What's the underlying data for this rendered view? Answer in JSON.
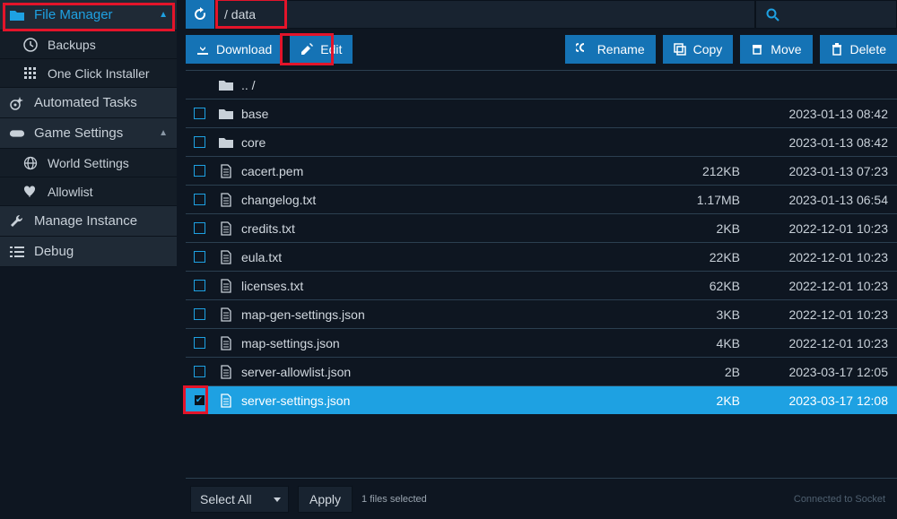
{
  "sidebar": {
    "sections": [
      {
        "id": "file-manager",
        "label": "File Manager",
        "active": true,
        "expandable": true,
        "children": [
          {
            "id": "backups",
            "label": "Backups",
            "icon": "backup"
          },
          {
            "id": "one-click",
            "label": "One Click Installer",
            "icon": "grid"
          }
        ]
      },
      {
        "id": "automated-tasks",
        "label": "Automated Tasks",
        "icon": "gear-spark",
        "expandable": false
      },
      {
        "id": "game-settings",
        "label": "Game Settings",
        "icon": "gamepad",
        "expandable": true,
        "children": [
          {
            "id": "world-settings",
            "label": "World Settings",
            "icon": "globe"
          },
          {
            "id": "allowlist",
            "label": "Allowlist",
            "icon": "heart"
          }
        ]
      },
      {
        "id": "manage-instance",
        "label": "Manage Instance",
        "icon": "wrench",
        "expandable": false
      },
      {
        "id": "debug",
        "label": "Debug",
        "icon": "list",
        "expandable": false
      }
    ]
  },
  "breadcrumb": {
    "path": "/   data"
  },
  "toolbar": {
    "download": "Download",
    "edit": "Edit",
    "rename": "Rename",
    "copy": "Copy",
    "move": "Move",
    "delete": "Delete"
  },
  "parent_label": ".. /",
  "files": [
    {
      "type": "folder",
      "name": "base",
      "size": "",
      "date": "2023-01-13 08:42",
      "selected": false
    },
    {
      "type": "folder",
      "name": "core",
      "size": "",
      "date": "2023-01-13 08:42",
      "selected": false
    },
    {
      "type": "file",
      "name": "cacert.pem",
      "size": "212KB",
      "date": "2023-01-13 07:23",
      "selected": false
    },
    {
      "type": "file",
      "name": "changelog.txt",
      "size": "1.17MB",
      "date": "2023-01-13 06:54",
      "selected": false
    },
    {
      "type": "file",
      "name": "credits.txt",
      "size": "2KB",
      "date": "2022-12-01 10:23",
      "selected": false
    },
    {
      "type": "file",
      "name": "eula.txt",
      "size": "22KB",
      "date": "2022-12-01 10:23",
      "selected": false
    },
    {
      "type": "file",
      "name": "licenses.txt",
      "size": "62KB",
      "date": "2022-12-01 10:23",
      "selected": false
    },
    {
      "type": "file",
      "name": "map-gen-settings.json",
      "size": "3KB",
      "date": "2022-12-01 10:23",
      "selected": false
    },
    {
      "type": "file",
      "name": "map-settings.json",
      "size": "4KB",
      "date": "2022-12-01 10:23",
      "selected": false
    },
    {
      "type": "file",
      "name": "server-allowlist.json",
      "size": "2B",
      "date": "2023-03-17 12:05",
      "selected": false
    },
    {
      "type": "file",
      "name": "server-settings.json",
      "size": "2KB",
      "date": "2023-03-17 12:08",
      "selected": true
    }
  ],
  "footer": {
    "select_all": "Select All",
    "apply": "Apply",
    "selected_text": "1 files selected",
    "socket": "Connected to Socket"
  }
}
